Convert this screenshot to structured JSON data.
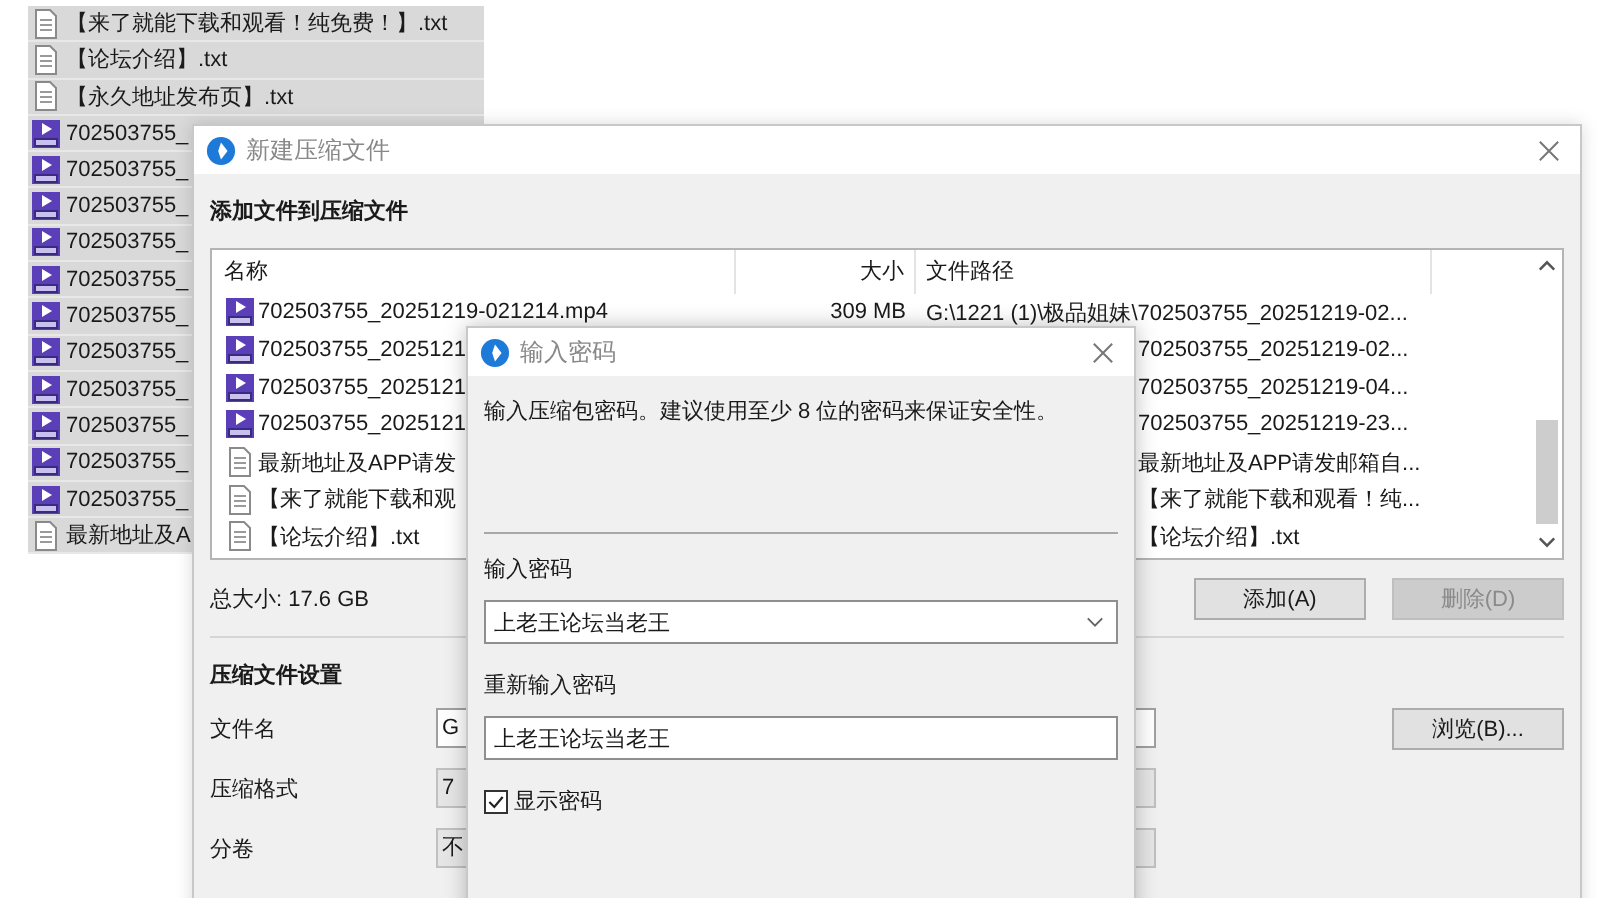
{
  "background_list": {
    "items": [
      {
        "kind": "txt",
        "name": "【来了就能下载和观看！纯免费！】.txt",
        "selected": true
      },
      {
        "kind": "txt",
        "name": "【论坛介绍】.txt",
        "selected": true
      },
      {
        "kind": "txt",
        "name": "【永久地址发布页】.txt",
        "selected": true
      },
      {
        "kind": "mp4",
        "name": "702503755_",
        "selected": true
      },
      {
        "kind": "mp4",
        "name": "702503755_",
        "selected": true
      },
      {
        "kind": "mp4",
        "name": "702503755_",
        "selected": true
      },
      {
        "kind": "mp4",
        "name": "702503755_",
        "selected": true
      },
      {
        "kind": "mp4",
        "name": "702503755_",
        "selected": true
      },
      {
        "kind": "mp4",
        "name": "702503755_",
        "selected": true
      },
      {
        "kind": "mp4",
        "name": "702503755_",
        "selected": true
      },
      {
        "kind": "mp4",
        "name": "702503755_",
        "selected": true
      },
      {
        "kind": "mp4",
        "name": "702503755_",
        "selected": true
      },
      {
        "kind": "mp4",
        "name": "702503755_",
        "selected": true
      },
      {
        "kind": "mp4",
        "name": "702503755_",
        "selected": true
      },
      {
        "kind": "txt",
        "name": "最新地址及A",
        "selected": true
      }
    ]
  },
  "compress_dialog": {
    "title": "新建压缩文件",
    "heading": "添加文件到压缩文件",
    "columns": [
      "名称",
      "大小",
      "文件路径"
    ],
    "files": [
      {
        "kind": "mp4",
        "name": "702503755_20251219-021214.mp4",
        "size": "309 MB",
        "path": "G:\\1221 (1)\\极品姐妹\\702503755_20251219-02..."
      },
      {
        "kind": "mp4",
        "name": "702503755_2025121",
        "path": "702503755_20251219-02..."
      },
      {
        "kind": "mp4",
        "name": "702503755_2025121",
        "path": "702503755_20251219-04..."
      },
      {
        "kind": "mp4",
        "name": "702503755_2025121",
        "path": "702503755_20251219-23..."
      },
      {
        "kind": "txt",
        "name": "最新地址及APP请发",
        "path": "最新地址及APP请发邮箱自..."
      },
      {
        "kind": "txt",
        "name": "【来了就能下载和观",
        "path": "【来了就能下载和观看！纯..."
      },
      {
        "kind": "txt",
        "name": "【论坛介绍】.txt",
        "path": "【论坛介绍】.txt"
      }
    ],
    "total": "总大小: 17.6 GB",
    "buttons": [
      {
        "label": "添加(A)",
        "disabled": false
      },
      {
        "label": "删除(D)",
        "disabled": true
      }
    ],
    "settings_heading": "压缩文件设置",
    "settings": [
      {
        "kind": "input",
        "label": "文件名",
        "value": "G",
        "button": "浏览(B)..."
      },
      {
        "kind": "combo",
        "label": "压缩格式",
        "value": "7"
      },
      {
        "kind": "combo",
        "label": "分卷",
        "value": "不"
      }
    ]
  },
  "password_dialog": {
    "title": "输入密码",
    "hint": "输入压缩包密码。建议使用至少 8 位的密码来保证安全性。",
    "password_label": "输入密码",
    "password": "上老王论坛当老王",
    "confirm_label": "重新输入密码",
    "confirm": "上老王论坛当老王",
    "show_password": {
      "label": "显示密码",
      "checked": true
    }
  }
}
